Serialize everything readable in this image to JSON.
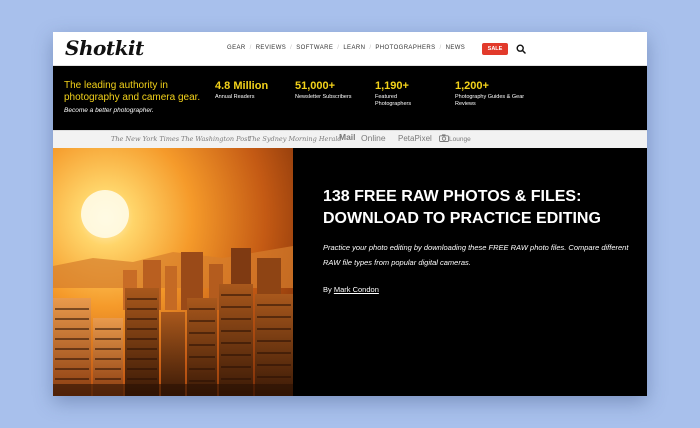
{
  "nav": {
    "logo": "Shotkit",
    "items": [
      "GEAR",
      "REVIEWS",
      "SOFTWARE",
      "LEARN",
      "PHOTOGRAPHERS",
      "NEWS"
    ],
    "sale_label": "SALE",
    "search_icon": "search-icon"
  },
  "stats_band": {
    "tagline": "The leading authority in photography and camera gear.",
    "tagline_sub": "Become a better photographer.",
    "stats": [
      {
        "value": "4.8 Million",
        "label": "Annual Readers"
      },
      {
        "value": "51,000+",
        "label": "Newsletter Subscribers"
      },
      {
        "value": "1,190+",
        "label": "Featured Photographers"
      },
      {
        "value": "1,200+",
        "label": "Photography Guides & Gear Reviews"
      }
    ]
  },
  "press": {
    "logos": [
      "The New York Times",
      "The Washington Post",
      "The Sydney Morning Herald",
      "Mail",
      "Online",
      "PetaPixel",
      "Lounge"
    ]
  },
  "hero": {
    "title": "138 FREE RAW PHOTOS & FILES: DOWNLOAD TO PRACTICE EDITING",
    "description": "Practice your photo editing by downloading these FREE RAW photo files. Compare different RAW file types from popular digital cameras.",
    "byline_prefix": "By ",
    "author": "Mark Condon"
  },
  "colors": {
    "accent_yellow": "#f3d21a",
    "sale_red": "#e23a2b",
    "background": "#a8c0ec"
  }
}
